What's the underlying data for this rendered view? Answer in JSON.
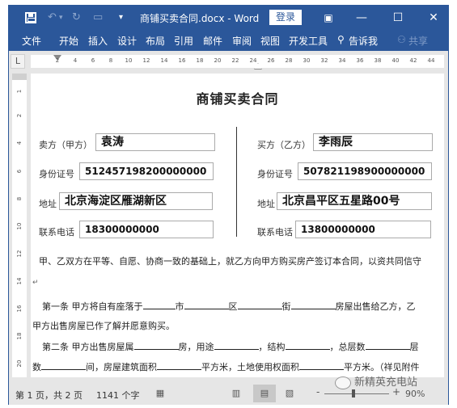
{
  "titlebar": {
    "doc_title": "商铺买卖合同.docx - Word",
    "login_label": "登录",
    "undo_glyph": "↶",
    "undo_dropdown_glyph": "▾",
    "redo_glyph": "↻",
    "touch_mode_glyph": "▭",
    "customize_glyph": "▾",
    "ribbon_display_glyph": "▣",
    "minimize_glyph": "—",
    "maximize_glyph": "☐",
    "close_glyph": "✕"
  },
  "ribbon": {
    "tabs": [
      "文件",
      "开始",
      "插入",
      "设计",
      "布局",
      "引用",
      "邮件",
      "审阅",
      "视图",
      "开发工具"
    ],
    "tell_me_icon": "⚲",
    "tell_me_label": "告诉我",
    "share_icon": "⚇",
    "share_label": "共享"
  },
  "ruler": {
    "corner_glyph": "L",
    "h_ticks": [
      "2",
      "4",
      "6",
      "8",
      "10",
      "12",
      "14",
      "16",
      "18",
      "20",
      "22",
      "24",
      "26",
      "28",
      "30",
      "32",
      "34",
      "36",
      "38",
      "40",
      "42",
      "44"
    ],
    "v_ticks": [
      "1",
      "2",
      "4",
      "6",
      "8",
      "10",
      "12",
      "14",
      "16",
      "18",
      "20"
    ]
  },
  "document": {
    "heading": "商铺买卖合同",
    "seller": {
      "name_label": "卖方（甲方）",
      "name": "袁涛",
      "id_label": "身份证号",
      "id": "512457198200000000",
      "address_label": "地址",
      "address": "北京海淀区雁湖新区",
      "phone_label": "联系电话",
      "phone": "18300000000"
    },
    "buyer": {
      "name_label": "买方（乙方）",
      "name": "李雨辰",
      "id_label": "身份证号",
      "id": "507821198900000000",
      "address_label": "地址",
      "address": "北京昌平区五星路00号",
      "phone_label": "联系电话",
      "phone": "13800000000"
    },
    "intro": "甲、乙双方在平等、自愿、协商一致的基础上，就乙方向甲方购买房产签订本合同，以资共同信守",
    "return_mark": "↵",
    "article1": {
      "p1": "第一条 甲方将自有座落于",
      "p2": "市",
      "p3": "区",
      "p4": "街",
      "p5": "房屋出售给乙方，乙",
      "line2": "甲方出售房屋已作了解并愿意购买。"
    },
    "article2": {
      "p1": "第二条 甲方出售房屋属",
      "p2": "房，用途",
      "p3": "，结构",
      "p4": "，总层数",
      "p5": "层",
      "l2_p1": "数",
      "l2_p2": "间，房屋建筑面积",
      "l2_p3": "平方米，土地使用权面积",
      "l2_p4": "平方米。（祥见附件"
    }
  },
  "statusbar": {
    "page_info": "第 1 页，共 2 页",
    "word_count": "1141 个字",
    "proofing_icon": "▦",
    "read_mode_icon": "▥",
    "print_layout_icon": "▤",
    "web_layout_icon": "▧",
    "zoom_minus": "-",
    "zoom_plus": "+",
    "zoom_level": "90%",
    "zoom_fraction": 0.45
  },
  "watermark": {
    "text": "新精英充电站"
  }
}
